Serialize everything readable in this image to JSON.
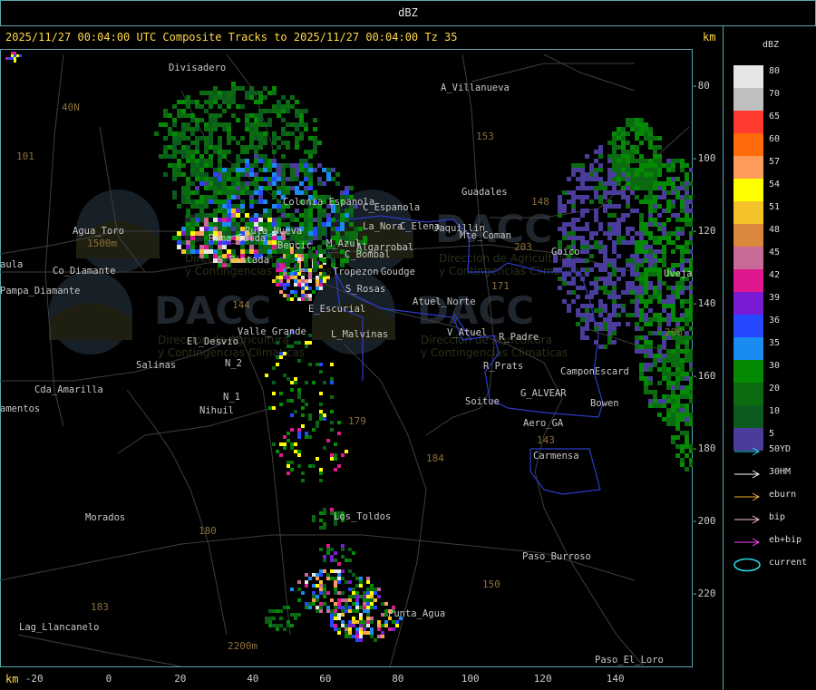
{
  "header": {
    "title": "dBZ",
    "subtitle": "2025/11/27 00:04:00 UTC Composite Tracks to 2025/11/27 00:04:00 Tz 35",
    "km_top": "km",
    "km_bottom": "km"
  },
  "axes": {
    "y_ticks": [
      "-80",
      "-100",
      "-120",
      "-140",
      "-160",
      "-180",
      "-200",
      "-220"
    ],
    "x_ticks": [
      "-20",
      "0",
      "20",
      "40",
      "60",
      "80",
      "100",
      "120",
      "140"
    ]
  },
  "legend": {
    "title": "dBZ",
    "scale": [
      {
        "label": "80",
        "color": "#e6e6e6"
      },
      {
        "label": "70",
        "color": "#bfbfbf"
      },
      {
        "label": "65",
        "color": "#ff3b2f"
      },
      {
        "label": "60",
        "color": "#ff6a0a"
      },
      {
        "label": "57",
        "color": "#ff9b5a"
      },
      {
        "label": "54",
        "color": "#ffff00"
      },
      {
        "label": "51",
        "color": "#f6c22a"
      },
      {
        "label": "48",
        "color": "#d9883b"
      },
      {
        "label": "45",
        "color": "#c86a98"
      },
      {
        "label": "42",
        "color": "#e0188f"
      },
      {
        "label": "39",
        "color": "#7a1cd6"
      },
      {
        "label": "36",
        "color": "#2648ff"
      },
      {
        "label": "35",
        "color": "#1a8bf0"
      },
      {
        "label": "30",
        "color": "#058a05"
      },
      {
        "label": "20",
        "color": "#0b6b10"
      },
      {
        "label": "10",
        "color": "#0b5a1e"
      },
      {
        "label": "5",
        "color": "#4a3c9a"
      }
    ],
    "tracks": [
      {
        "label": "50YD",
        "color": "#2ad4e6"
      },
      {
        "label": "30HM",
        "color": "#ffffff"
      },
      {
        "label": "eburn",
        "color": "#f2b13a"
      },
      {
        "label": "bip",
        "color": "#ffc0d0"
      },
      {
        "label": "eb+bip",
        "color": "#ff40ff"
      },
      {
        "label": "current",
        "color": "#2ad4e6"
      }
    ]
  },
  "map": {
    "places": [
      {
        "name": "Divisadero"
      },
      {
        "name": "A_Villanueva"
      },
      {
        "name": "40N"
      },
      {
        "name": "101"
      },
      {
        "name": "153"
      },
      {
        "name": "Guadales"
      },
      {
        "name": "148"
      },
      {
        "name": "C_Espanola"
      },
      {
        "name": "Colonia Espanola"
      },
      {
        "name": "La_Nora"
      },
      {
        "name": "C_Elena"
      },
      {
        "name": "Jaquillin"
      },
      {
        "name": "Mte_Coman"
      },
      {
        "name": "Agua_Toro"
      },
      {
        "name": "1500m"
      },
      {
        "name": "Rama_Calda"
      },
      {
        "name": "Ruta_Nueva"
      },
      {
        "name": "Bencic"
      },
      {
        "name": "M_Azul"
      },
      {
        "name": "Algarrobal"
      },
      {
        "name": "C_Bombal"
      },
      {
        "name": "203"
      },
      {
        "name": "Goico"
      },
      {
        "name": "S_Pintada"
      },
      {
        "name": "Tropezon"
      },
      {
        "name": "Goudge"
      },
      {
        "name": "aula"
      },
      {
        "name": "Co_Diamante"
      },
      {
        "name": "Pampa_Diamante"
      },
      {
        "name": "S_Rosas"
      },
      {
        "name": "171"
      },
      {
        "name": "Atuel_Norte"
      },
      {
        "name": "Uveja"
      },
      {
        "name": "E_Escurial"
      },
      {
        "name": "144"
      },
      {
        "name": "El_Desvio"
      },
      {
        "name": "Valle_Grande"
      },
      {
        "name": "L_Malvinas"
      },
      {
        "name": "V_Atuel"
      },
      {
        "name": "R_Padre"
      },
      {
        "name": "206"
      },
      {
        "name": "Salinas"
      },
      {
        "name": "N_2"
      },
      {
        "name": "R_Prats"
      },
      {
        "name": "CamponEscard"
      },
      {
        "name": "Cda_Amarilla"
      },
      {
        "name": "N_1"
      },
      {
        "name": "G_ALVEAR"
      },
      {
        "name": "amentos"
      },
      {
        "name": "Nihuil"
      },
      {
        "name": "Soitue"
      },
      {
        "name": "Bowen"
      },
      {
        "name": "179"
      },
      {
        "name": "Aero_GA"
      },
      {
        "name": "184"
      },
      {
        "name": "143"
      },
      {
        "name": "Carmensa"
      },
      {
        "name": "Morados"
      },
      {
        "name": "Los_Toldos"
      },
      {
        "name": "180"
      },
      {
        "name": "Paso_Burroso"
      },
      {
        "name": "150"
      },
      {
        "name": "Lag_Llancanelo"
      },
      {
        "name": "183"
      },
      {
        "name": "Punta_Agua"
      },
      {
        "name": "2200m"
      },
      {
        "name": "Paso_El_Loro"
      }
    ],
    "watermark": {
      "logo": "DACC",
      "line1": "Direccion de Agricultura",
      "line2": "y Contingencias Climaticas"
    }
  }
}
